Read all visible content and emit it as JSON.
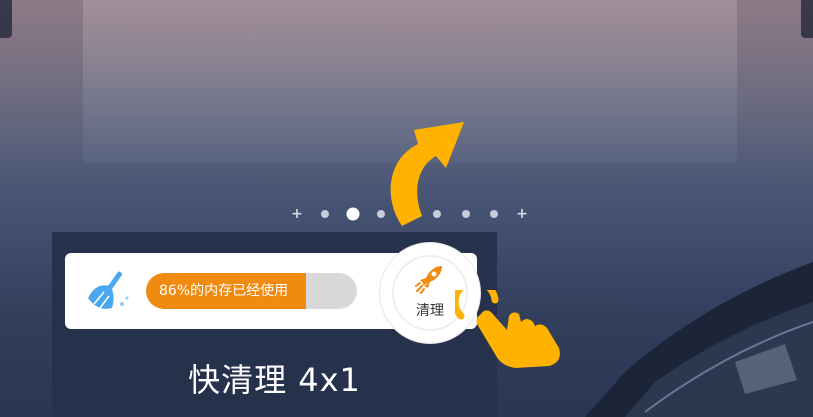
{
  "widget": {
    "memory_text": "86%的内存已经使用",
    "memory_used_fraction": 0.76,
    "clean_button_label": "清理",
    "title": "快清理 4x1"
  },
  "page_indicator": {
    "items": [
      "plus",
      "dot",
      "active",
      "dot",
      "dot",
      "dot",
      "dot",
      "plus"
    ]
  },
  "colors": {
    "accent_orange": "#f08a10",
    "arrow_yellow": "#ffb300",
    "broom_blue": "#4aa8f0",
    "progress_track": "#d8d8d8"
  },
  "icons": [
    "broom-icon",
    "rocket-icon",
    "tap-hand-icon",
    "curved-arrow-icon"
  ]
}
